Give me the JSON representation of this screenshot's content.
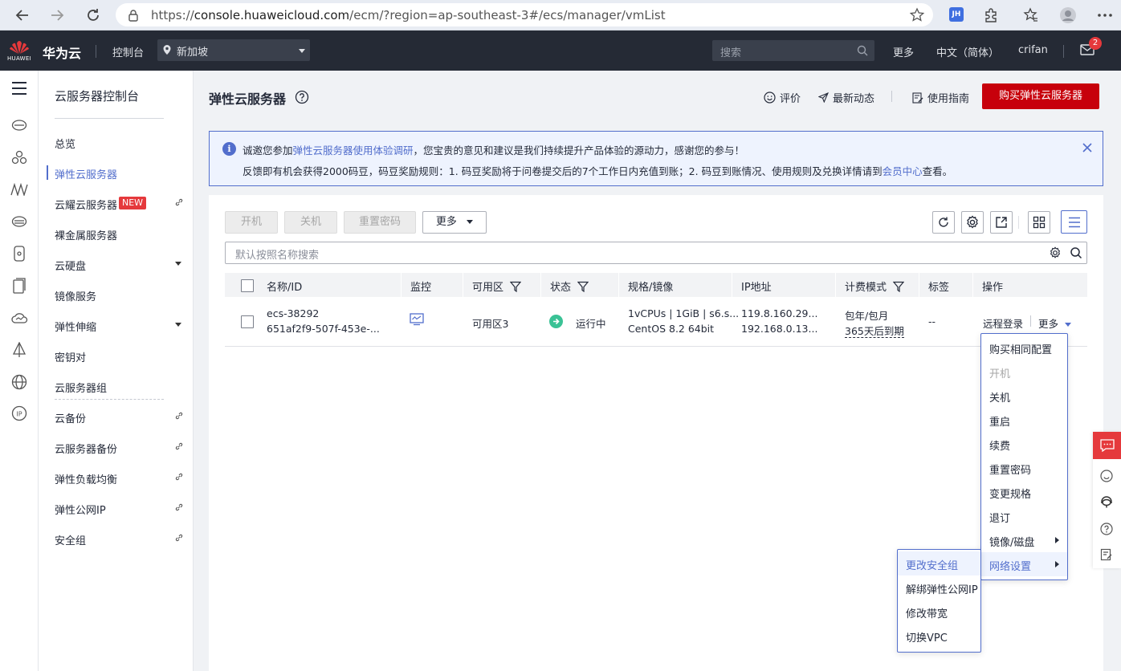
{
  "browser": {
    "url_prefix": "https://",
    "url_host": "console.huaweicloud.com",
    "url_path": "/ecm/?region=ap-southeast-3#/ecs/manager/vmList",
    "profile_badge": "JH"
  },
  "topnav": {
    "logo_text": "HUAWEI",
    "brand": "华为云",
    "console": "控制台",
    "region": "新加坡",
    "search_placeholder": "搜索",
    "more": "更多",
    "language": "中文（简体）",
    "user": "crifan",
    "message_count": "2"
  },
  "sidebar": {
    "title": "云服务器控制台",
    "items": [
      {
        "label": "总览"
      },
      {
        "label": "弹性云服务器"
      },
      {
        "label": "云耀云服务器",
        "badge": "NEW"
      },
      {
        "label": "裸金属服务器"
      },
      {
        "label": "云硬盘"
      },
      {
        "label": "镜像服务"
      },
      {
        "label": "弹性伸缩"
      },
      {
        "label": "密钥对"
      },
      {
        "label": "云服务器组"
      },
      {
        "label": "云备份"
      },
      {
        "label": "云服务器备份"
      },
      {
        "label": "弹性负载均衡"
      },
      {
        "label": "弹性公网IP"
      },
      {
        "label": "安全组"
      }
    ]
  },
  "header": {
    "title": "弹性云服务器",
    "rate": "评价",
    "news": "最新动态",
    "guide": "使用指南",
    "buy": "购买弹性云服务器"
  },
  "notice": {
    "l1_a": "诚邀您参加",
    "l1_link": "弹性云服务器使用体验调研",
    "l1_b": "，您宝贵的意见和建议是我们持续提升产品体验的源动力，感谢您的参与！",
    "l2_a": "反馈即有机会获得2000码豆，码豆奖励规则：1. 码豆奖励将于问卷提交后的7个工作日内充值到账；2. 码豆到账情况、使用规则及兑换详情请到",
    "l2_link": "会员中心",
    "l2_b": "查看。"
  },
  "toolbar": {
    "start": "开机",
    "stop": "关机",
    "reset_pwd": "重置密码",
    "more": "更多",
    "search_placeholder": "默认按照名称搜索"
  },
  "table": {
    "headers": {
      "name": "名称/ID",
      "monitor": "监控",
      "az": "可用区",
      "status": "状态",
      "spec": "规格/镜像",
      "ip": "IP地址",
      "billing": "计费模式",
      "tags": "标签",
      "ops": "操作"
    },
    "rows": [
      {
        "name": "ecs-38292",
        "id": "651af2f9-507f-453e-...",
        "az": "可用区3",
        "status": "运行中",
        "spec": "1vCPUs | 1GiB | s6.s...",
        "image": "CentOS 8.2 64bit",
        "public_ip": "119.8.160.29...",
        "private_ip": "192.168.0.13...",
        "billing": "包年/包月",
        "billing_expiry": "365天后到期",
        "tags": "--",
        "remote_login": "远程登录",
        "more": "更多"
      }
    ]
  },
  "more_menu": {
    "items": [
      {
        "label": "购买相同配置"
      },
      {
        "label": "开机"
      },
      {
        "label": "关机"
      },
      {
        "label": "重启"
      },
      {
        "label": "续费"
      },
      {
        "label": "重置密码"
      },
      {
        "label": "变更规格"
      },
      {
        "label": "退订"
      },
      {
        "label": "镜像/磁盘"
      },
      {
        "label": "网络设置"
      }
    ]
  },
  "network_menu": {
    "items": [
      {
        "label": "更改安全组"
      },
      {
        "label": "解绑弹性公网IP"
      },
      {
        "label": "修改带宽"
      },
      {
        "label": "切换VPC"
      }
    ]
  },
  "colors": {
    "brand_red": "#c7000b",
    "link_blue": "#526ecc",
    "nav_dark": "#252a35",
    "status_green": "#3ac295"
  }
}
